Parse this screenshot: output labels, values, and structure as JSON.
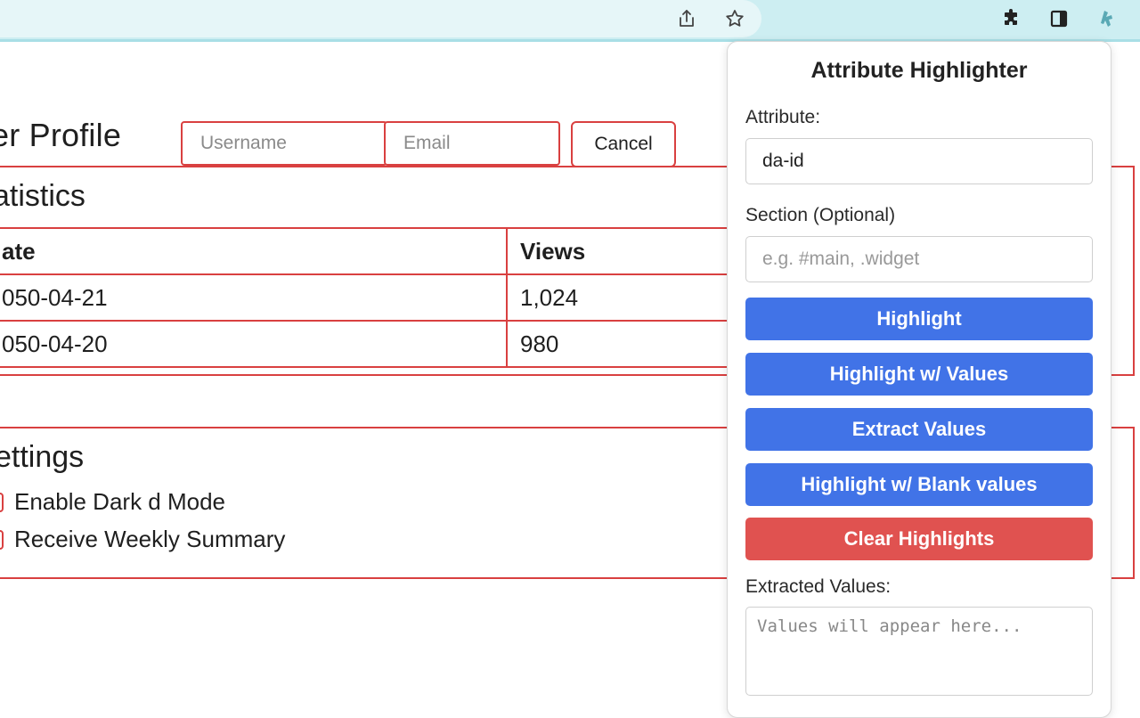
{
  "toolbar": {
    "icons": [
      "share-icon",
      "bookmark-star-icon",
      "extensions-puzzle-icon",
      "side-panel-icon",
      "extension-icon"
    ]
  },
  "page": {
    "title": "er Profile",
    "username_placeholder": "Username",
    "email_placeholder": "Email",
    "cancel_label": "Cancel",
    "statistics": {
      "heading": "atistics",
      "columns": [
        "ate",
        "Views"
      ],
      "rows": [
        [
          "050-04-21",
          "1,024"
        ],
        [
          "050-04-20",
          "980"
        ]
      ]
    },
    "settings": {
      "heading": "ettings",
      "items": [
        "Enable Dark d Mode",
        "Receive Weekly Summary"
      ]
    }
  },
  "popup": {
    "title": "Attribute Highlighter",
    "attribute_label": "Attribute:",
    "attribute_value": "da-id",
    "section_label": "Section (Optional)",
    "section_placeholder": "e.g. #main, .widget",
    "buttons": {
      "highlight": "Highlight",
      "highlight_values": "Highlight w/ Values",
      "extract": "Extract Values",
      "highlight_blank": "Highlight w/ Blank values",
      "clear": "Clear Highlights"
    },
    "extracted_label": "Extracted Values:",
    "extracted_placeholder": "Values will appear here..."
  },
  "colors": {
    "accent_border": "#d94040",
    "primary_button": "#4173e7",
    "danger_button": "#e05250",
    "toolbar_bg": "#cdeef2"
  }
}
